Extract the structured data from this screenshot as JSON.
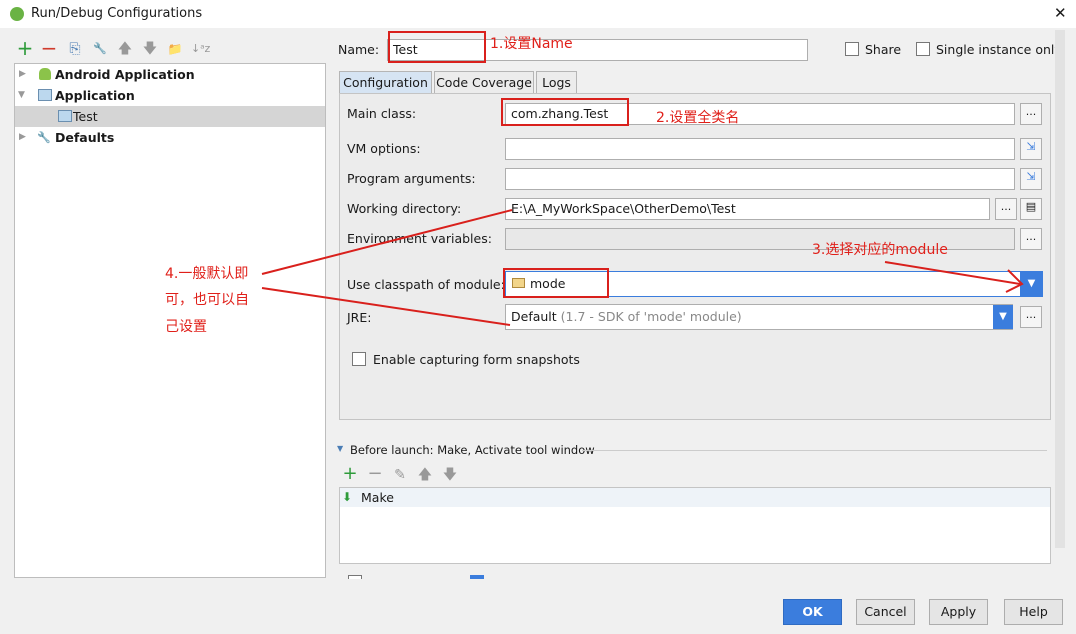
{
  "window": {
    "title": "Run/Debug Configurations",
    "close": "✕"
  },
  "toolbar": {
    "add": "+",
    "remove": "−",
    "copy": "⎘",
    "edit": "🔧",
    "up": "🡅",
    "down": "🡇",
    "folder": "📁",
    "sort": "↓ᵃz"
  },
  "tree": [
    {
      "label": "Android Application",
      "bold": true,
      "expanded": false
    },
    {
      "label": "Application",
      "bold": true,
      "expanded": true
    },
    {
      "label": "Test",
      "bold": false,
      "selected": true
    },
    {
      "label": "Defaults",
      "bold": true,
      "expanded": false
    }
  ],
  "name": {
    "label": "Name:",
    "value": "Test",
    "share": "Share",
    "single_instance": "Single instance only"
  },
  "tabs": [
    {
      "label": "Configuration",
      "active": true
    },
    {
      "label": "Code Coverage"
    },
    {
      "label": "Logs"
    }
  ],
  "form": {
    "main_class": {
      "label": "Main class:",
      "value": "com.zhang.Test"
    },
    "vm_options": {
      "label": "VM options:",
      "value": ""
    },
    "program_arguments": {
      "label": "Program arguments:",
      "value": ""
    },
    "working_directory": {
      "label": "Working directory:",
      "value": "E:\\A_MyWorkSpace\\OtherDemo\\Test"
    },
    "env_vars": {
      "label": "Environment variables:",
      "value": ""
    },
    "classpath_module": {
      "label": "Use classpath of module:",
      "value": "mode"
    },
    "jre": {
      "label": "JRE:",
      "value": "Default",
      "hint": "(1.7 - SDK of 'mode' module)"
    },
    "snapshots": {
      "label": "Enable capturing form snapshots",
      "checked": false
    },
    "ellipsis": "..."
  },
  "before_launch": {
    "title": "Before launch: Make, Activate tool window",
    "items": [
      "Make"
    ]
  },
  "buttons": {
    "ok": "OK",
    "cancel": "Cancel",
    "apply": "Apply",
    "help": "Help"
  },
  "annotations": {
    "a1": "1.设置Name",
    "a2": "2.设置全类名",
    "a3": "3.选择对应的module",
    "a4": [
      "4.一般默认即",
      "可，也可以自",
      "己设置"
    ],
    "color": "#d9201c"
  },
  "colors": {
    "accent": "#3b7ddd",
    "selection": "#d5d5d5"
  }
}
